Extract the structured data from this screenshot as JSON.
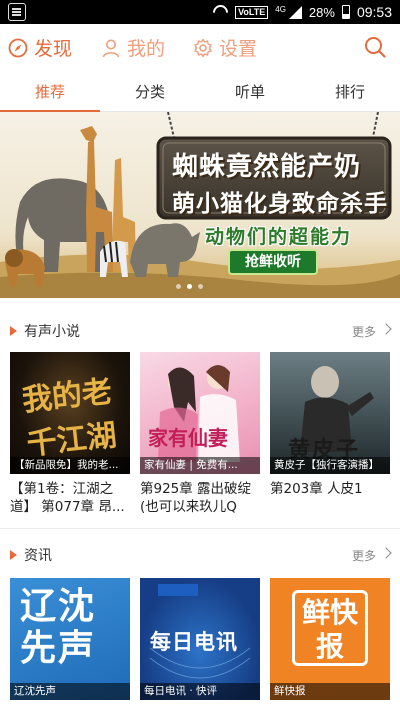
{
  "status_bar": {
    "network": "4G",
    "volte": "VoLTE",
    "battery": "28%",
    "time": "09:53"
  },
  "nav": {
    "find": "发现",
    "mine": "我的",
    "settings": "设置"
  },
  "tabs": [
    {
      "label": "推荐",
      "active": true
    },
    {
      "label": "分类",
      "active": false
    },
    {
      "label": "听单",
      "active": false
    },
    {
      "label": "排行",
      "active": false
    }
  ],
  "banner": {
    "title_line1": "蜘蛛竟然能产奶",
    "title_line2": "萌小猫化身致命杀手",
    "subtitle": "动物们的超能力",
    "button": "抢鲜收听",
    "active_slide": 2,
    "slide_count": 3
  },
  "sections": [
    {
      "title": "有声小说",
      "more": "更多",
      "items": [
        {
          "cover_title": "我的老千江湖",
          "caption": "【新品限免】我的老...",
          "desc": "【第1卷：江湖之道】 第077章 昂..."
        },
        {
          "cover_title": "家有仙妻",
          "caption": "家有仙妻 | 免费有...",
          "desc": "第925章 露出破绽(也可以来玖儿Q群..."
        },
        {
          "cover_title": "黄皮子",
          "caption": "黄皮子【独行客演播】",
          "desc": "第203章 人皮1"
        }
      ]
    },
    {
      "title": "资讯",
      "more": "更多",
      "items": [
        {
          "cover_title": "辽沈先声",
          "caption": "辽沈先声"
        },
        {
          "cover_title": "每日电讯",
          "caption": "每日电讯 · 快评"
        },
        {
          "cover_title": "鲜快报",
          "caption": "鲜快报"
        }
      ]
    }
  ],
  "colors": {
    "accent": "#e56b3c",
    "accent_light": "#ef9e7e"
  }
}
